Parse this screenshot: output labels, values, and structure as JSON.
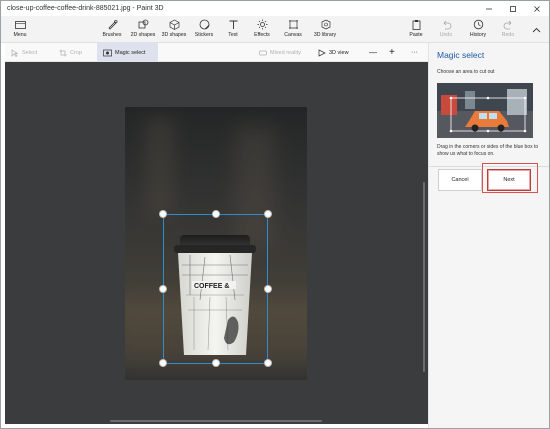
{
  "window": {
    "title": "close-up-coffee-coffee-drink-885021.jpg - Paint 3D",
    "controls": [
      "minimize",
      "maximize",
      "close"
    ]
  },
  "ribbon": {
    "menu_label": "Menu",
    "tools": [
      {
        "label": "Brushes",
        "icon": "brush-icon"
      },
      {
        "label": "2D shapes",
        "icon": "shapes-2d-icon"
      },
      {
        "label": "3D shapes",
        "icon": "cube-icon"
      },
      {
        "label": "Stickers",
        "icon": "sticker-icon"
      },
      {
        "label": "Text",
        "icon": "text-icon"
      },
      {
        "label": "Effects",
        "icon": "sun-icon"
      },
      {
        "label": "Canvas",
        "icon": "canvas-icon"
      },
      {
        "label": "3D library",
        "icon": "library-icon"
      }
    ],
    "right": [
      {
        "label": "Paste",
        "icon": "paste-icon"
      },
      {
        "label": "Undo",
        "icon": "undo-icon"
      },
      {
        "label": "History",
        "icon": "history-icon"
      },
      {
        "label": "Redo",
        "icon": "redo-icon"
      }
    ]
  },
  "toolbar": {
    "select_label": "Select",
    "crop_label": "Crop",
    "magic_select_label": "Magic select",
    "mixed_reality_label": "Mixed reality",
    "view_3d_label": "3D view",
    "zoom_out_symbol": "—",
    "zoom_in_symbol": "+",
    "more_symbol": "···"
  },
  "canvas": {
    "cup_text": "COFFEE &"
  },
  "panel": {
    "title": "Magic select",
    "subtitle": "Choose an area to cut out",
    "description": "Drag in the corners or sides of the blue box to show us what to focus on.",
    "cancel_label": "Cancel",
    "next_label": "Next"
  },
  "colors": {
    "accent": "#1f5aa6",
    "selection": "#2d8ecf",
    "highlight": "#d9534f",
    "canvas_bg": "#3a3c3d"
  }
}
